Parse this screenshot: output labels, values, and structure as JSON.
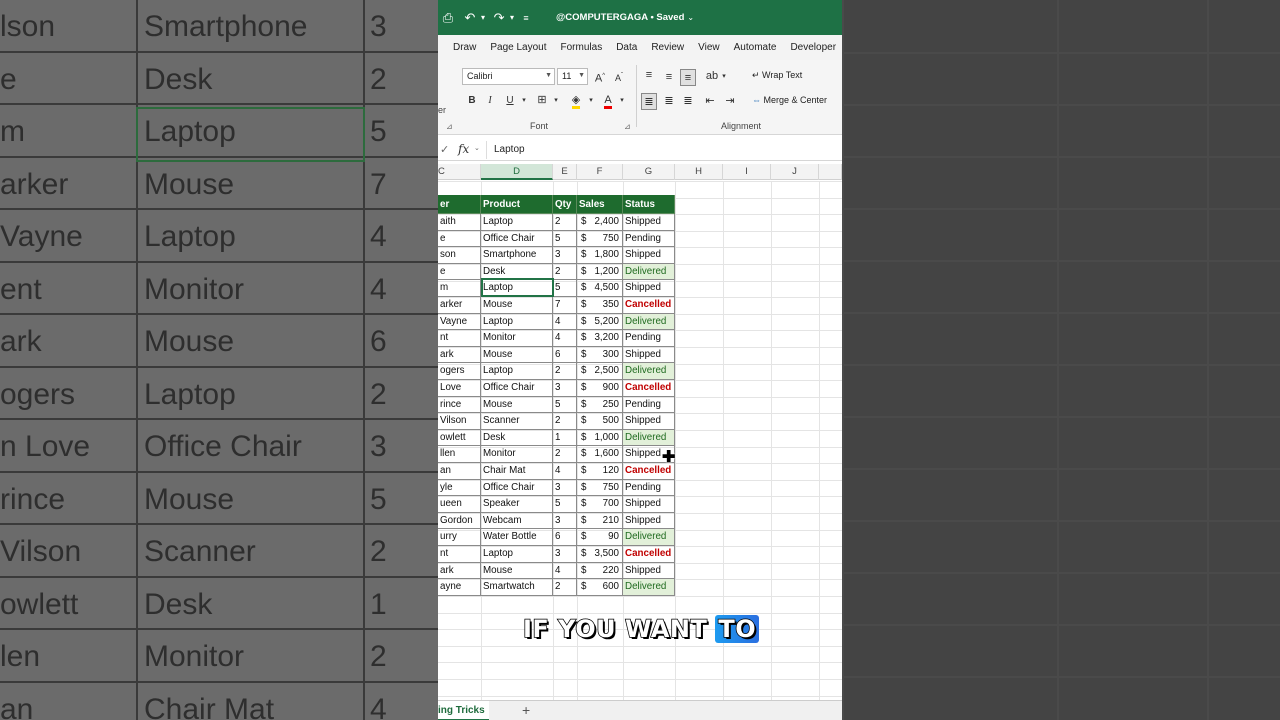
{
  "background": {
    "rows": [
      {
        "name": "lson",
        "product": "Smartphone",
        "qty": "3"
      },
      {
        "name": "e",
        "product": "Desk",
        "qty": "2"
      },
      {
        "name": "m",
        "product": "Laptop",
        "qty": "5"
      },
      {
        "name": "arker",
        "product": "Mouse",
        "qty": "7"
      },
      {
        "name": "Vayne",
        "product": "Laptop",
        "qty": "4"
      },
      {
        "name": "ent",
        "product": "Monitor",
        "qty": "4"
      },
      {
        "name": "ark",
        "product": "Mouse",
        "qty": "6"
      },
      {
        "name": "ogers",
        "product": "Laptop",
        "qty": "2"
      },
      {
        "name": "n Love",
        "product": "Office Chair",
        "qty": "3"
      },
      {
        "name": "rince",
        "product": "Mouse",
        "qty": "5"
      },
      {
        "name": "Vilson",
        "product": "Scanner",
        "qty": "2"
      },
      {
        "name": "owlett",
        "product": "Desk",
        "qty": "1"
      },
      {
        "name": "len",
        "product": "Monitor",
        "qty": "2"
      },
      {
        "name": "an",
        "product": "Chair Mat",
        "qty": "4"
      }
    ]
  },
  "titlebar": {
    "title": "@COMPUTERGAGA • Saved",
    "save_icon": "⎙",
    "undo_icon": "↶",
    "redo_icon": "↷",
    "customize_icon": "≡"
  },
  "menu": [
    "Draw",
    "Page Layout",
    "Formulas",
    "Data",
    "Review",
    "View",
    "Automate",
    "Developer"
  ],
  "ribbon": {
    "font_name": "Calibri",
    "font_size": "11",
    "font_group_label": "Font",
    "alignment_group_label": "Alignment",
    "wrap_text": "Wrap Text",
    "merge_center": "Merge & Center",
    "clipped_group_label": "er"
  },
  "formula_bar": {
    "value": "Laptop"
  },
  "columns": [
    "C",
    "D",
    "E",
    "F",
    "G",
    "H",
    "I",
    "J"
  ],
  "table": {
    "headers": {
      "name": "er",
      "product": "Product",
      "qty": "Qty",
      "sales": "Sales",
      "status": "Status"
    },
    "currency": "$",
    "rows": [
      {
        "name": "aith",
        "product": "Laptop",
        "qty": "2",
        "sales": "2,400",
        "status": "Shipped"
      },
      {
        "name": "e",
        "product": "Office Chair",
        "qty": "5",
        "sales": "750",
        "status": "Pending"
      },
      {
        "name": "son",
        "product": "Smartphone",
        "qty": "3",
        "sales": "1,800",
        "status": "Shipped"
      },
      {
        "name": "e",
        "product": "Desk",
        "qty": "2",
        "sales": "1,200",
        "status": "Delivered"
      },
      {
        "name": "m",
        "product": "Laptop",
        "qty": "5",
        "sales": "4,500",
        "status": "Shipped"
      },
      {
        "name": "arker",
        "product": "Mouse",
        "qty": "7",
        "sales": "350",
        "status": "Cancelled"
      },
      {
        "name": "Vayne",
        "product": "Laptop",
        "qty": "4",
        "sales": "5,200",
        "status": "Delivered"
      },
      {
        "name": "nt",
        "product": "Monitor",
        "qty": "4",
        "sales": "3,200",
        "status": "Pending"
      },
      {
        "name": "ark",
        "product": "Mouse",
        "qty": "6",
        "sales": "300",
        "status": "Shipped"
      },
      {
        "name": "ogers",
        "product": "Laptop",
        "qty": "2",
        "sales": "2,500",
        "status": "Delivered"
      },
      {
        "name": "Love",
        "product": "Office Chair",
        "qty": "3",
        "sales": "900",
        "status": "Cancelled"
      },
      {
        "name": "rince",
        "product": "Mouse",
        "qty": "5",
        "sales": "250",
        "status": "Pending"
      },
      {
        "name": "Vilson",
        "product": "Scanner",
        "qty": "2",
        "sales": "500",
        "status": "Shipped"
      },
      {
        "name": "owlett",
        "product": "Desk",
        "qty": "1",
        "sales": "1,000",
        "status": "Delivered"
      },
      {
        "name": "llen",
        "product": "Monitor",
        "qty": "2",
        "sales": "1,600",
        "status": "Shipped"
      },
      {
        "name": "an",
        "product": "Chair Mat",
        "qty": "4",
        "sales": "120",
        "status": "Cancelled"
      },
      {
        "name": "yle",
        "product": "Office Chair",
        "qty": "3",
        "sales": "750",
        "status": "Pending"
      },
      {
        "name": "ueen",
        "product": "Speaker",
        "qty": "5",
        "sales": "700",
        "status": "Shipped"
      },
      {
        "name": "Gordon",
        "product": "Webcam",
        "qty": "3",
        "sales": "210",
        "status": "Shipped"
      },
      {
        "name": "urry",
        "product": "Water Bottle",
        "qty": "6",
        "sales": "90",
        "status": "Delivered"
      },
      {
        "name": "nt",
        "product": "Laptop",
        "qty": "3",
        "sales": "3,500",
        "status": "Cancelled"
      },
      {
        "name": "ark",
        "product": "Mouse",
        "qty": "4",
        "sales": "220",
        "status": "Shipped"
      },
      {
        "name": "ayne",
        "product": "Smartwatch",
        "qty": "2",
        "sales": "600",
        "status": "Delivered"
      }
    ]
  },
  "sheet_tab": "ing Tricks",
  "add_sheet": "+",
  "caption": {
    "text": "IF YOU WANT",
    "highlight": "TO"
  },
  "colors": {
    "excel_green": "#1e7145",
    "header_fill": "#1e6b2e",
    "delivered_fill": "#e2f0d9",
    "cancelled_text": "#c00000"
  }
}
